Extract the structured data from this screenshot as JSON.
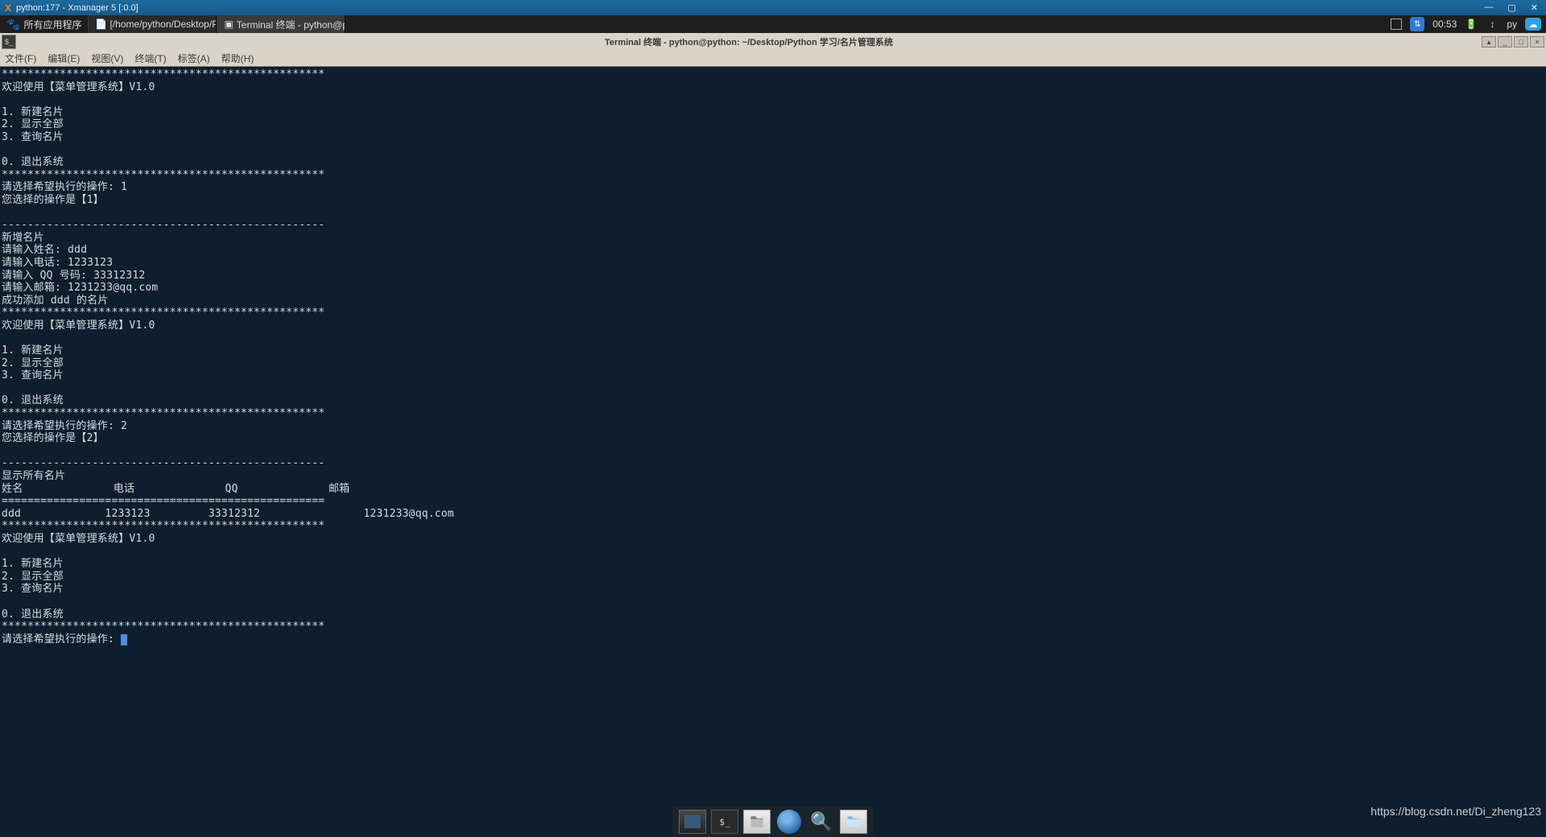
{
  "xmanager": {
    "title": "python:177 - Xmanager 5 [:0.0]"
  },
  "panel": {
    "apps_label": "所有应用程序",
    "task1": "[/home/python/Desktop/Pyth...",
    "task2": "Terminal 终端 - python@pyth...",
    "clock": "00:53",
    "py_label": "py"
  },
  "terminal": {
    "title": "Terminal 终端 - python@python: ~/Desktop/Python 学习/名片管理系统",
    "menu": {
      "file": "文件(F)",
      "edit": "编辑(E)",
      "view": "视图(V)",
      "terminal": "终端(T)",
      "tabs": "标签(A)",
      "help": "帮助(H)"
    },
    "lines": [
      "**************************************************",
      "欢迎使用【菜单管理系统】V1.0",
      "",
      "1. 新建名片",
      "2. 显示全部",
      "3. 查询名片",
      "",
      "0. 退出系统",
      "**************************************************",
      "请选择希望执行的操作: 1",
      "您选择的操作是【1】",
      "",
      "--------------------------------------------------",
      "新增名片",
      "请输入姓名: ddd",
      "请输入电话: 1233123",
      "请输入 QQ 号码: 33312312",
      "请输入邮箱: 1231233@qq.com",
      "成功添加 ddd 的名片",
      "**************************************************",
      "欢迎使用【菜单管理系统】V1.0",
      "",
      "1. 新建名片",
      "2. 显示全部",
      "3. 查询名片",
      "",
      "0. 退出系统",
      "**************************************************",
      "请选择希望执行的操作: 2",
      "您选择的操作是【2】",
      "",
      "--------------------------------------------------",
      "显示所有名片",
      "姓名              电话              QQ              邮箱",
      "==================================================",
      "ddd             1233123         33312312                1231233@qq.com",
      "**************************************************",
      "欢迎使用【菜单管理系统】V1.0",
      "",
      "1. 新建名片",
      "2. 显示全部",
      "3. 查询名片",
      "",
      "0. 退出系统",
      "**************************************************",
      "请选择希望执行的操作: "
    ]
  },
  "watermark": "https://blog.csdn.net/Di_zheng123"
}
